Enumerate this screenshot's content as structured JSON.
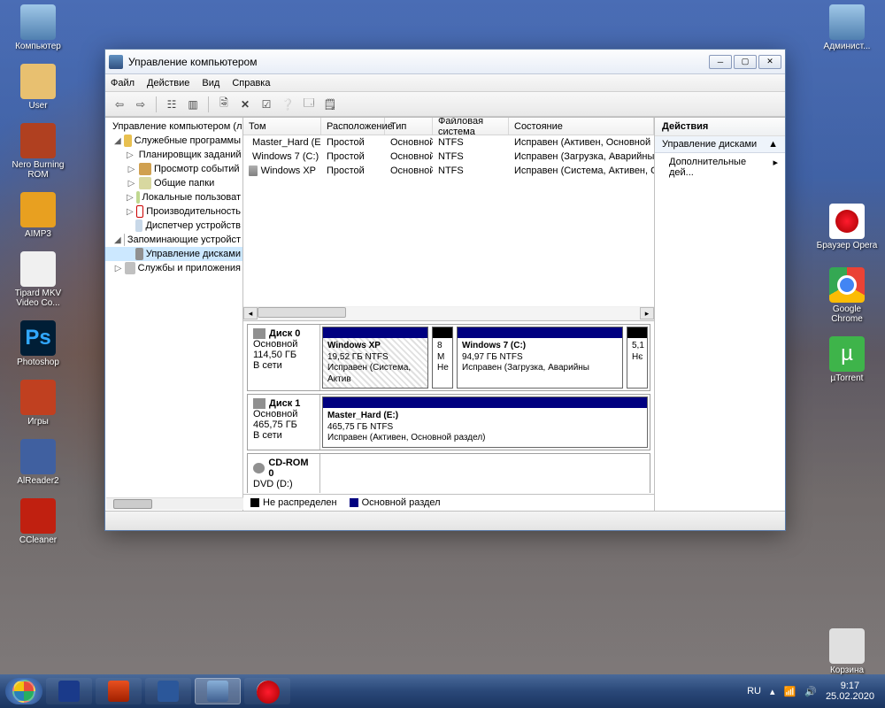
{
  "desktop": {
    "left_icons": [
      {
        "label": "Компьютер",
        "cls": "ico-computer"
      },
      {
        "label": "User",
        "cls": "ico-user"
      },
      {
        "label": "Nero Burning ROM",
        "cls": "ico-nero"
      },
      {
        "label": "AIMP3",
        "cls": "ico-aimp"
      },
      {
        "label": "Tipard MKV Video Co...",
        "cls": "ico-mkv"
      },
      {
        "label": "Photoshop",
        "cls": "ico-ps",
        "glyph": "Ps"
      },
      {
        "label": "Игры",
        "cls": "ico-games"
      },
      {
        "label": "AlReader2",
        "cls": "ico-reader"
      },
      {
        "label": "CCleaner",
        "cls": "ico-ccleaner"
      }
    ],
    "right_icons": [
      {
        "label": "Админист...",
        "cls": "ico-admin"
      },
      {
        "label": "Браузер Opera",
        "cls": "ico-opera"
      },
      {
        "label": "Google Chrome",
        "cls": "ico-chrome"
      },
      {
        "label": "µTorrent",
        "cls": "ico-utorrent",
        "glyph": "µ"
      },
      {
        "label": "Корзина",
        "cls": "ico-bin"
      }
    ]
  },
  "window": {
    "title": "Управление компьютером",
    "menu": [
      "Файл",
      "Действие",
      "Вид",
      "Справка"
    ],
    "tree": {
      "root": "Управление компьютером (л",
      "tools": "Служебные программы",
      "sched": "Планировщик заданий",
      "event": "Просмотр событий",
      "share": "Общие папки",
      "users": "Локальные пользоват",
      "perf": "Производительность",
      "devmgr": "Диспетчер устройств",
      "storage": "Запоминающие устройст",
      "diskmgmt": "Управление дисками",
      "services": "Службы и приложения"
    },
    "columns": {
      "vol": "Том",
      "layout": "Расположение",
      "type": "Тип",
      "fs": "Файловая система",
      "status": "Состояние"
    },
    "volumes": [
      {
        "name": "Master_Hard (E:)",
        "layout": "Простой",
        "type": "Основной",
        "fs": "NTFS",
        "status": "Исправен (Активен, Основной разд"
      },
      {
        "name": "Windows 7 (C:)",
        "layout": "Простой",
        "type": "Основной",
        "fs": "NTFS",
        "status": "Исправен (Загрузка, Аварийный д"
      },
      {
        "name": "Windows XP",
        "layout": "Простой",
        "type": "Основной",
        "fs": "NTFS",
        "status": "Исправен (Система, Активен, Осно"
      }
    ],
    "disks": {
      "d0": {
        "name": "Диск 0",
        "type": "Основной",
        "size": "114,50 ГБ",
        "online": "В сети"
      },
      "d0_p1": {
        "name": "Windows XP",
        "size": "19,52 ГБ NTFS",
        "status": "Исправен (Система, Актив"
      },
      "d0_u1": {
        "size": "8 М",
        "status": "Не"
      },
      "d0_p2": {
        "name": "Windows 7  (C:)",
        "size": "94,97 ГБ NTFS",
        "status": "Исправен (Загрузка, Аварийны"
      },
      "d0_u2": {
        "size": "5,1",
        "status": "Нє"
      },
      "d1": {
        "name": "Диск 1",
        "type": "Основной",
        "size": "465,75 ГБ",
        "online": "В сети"
      },
      "d1_p1": {
        "name": "Master_Hard  (E:)",
        "size": "465,75 ГБ NTFS",
        "status": "Исправен (Активен, Основной раздел)"
      },
      "cd": {
        "name": "CD-ROM 0",
        "type": "DVD (D:)"
      }
    },
    "legend": {
      "unalloc": "Не распределен",
      "primary": "Основной раздел"
    },
    "actions": {
      "header": "Действия",
      "section": "Управление дисками",
      "more": "Дополнительные дей..."
    }
  },
  "taskbar": {
    "lang": "RU",
    "time": "9:17",
    "date": "25.02.2020"
  }
}
